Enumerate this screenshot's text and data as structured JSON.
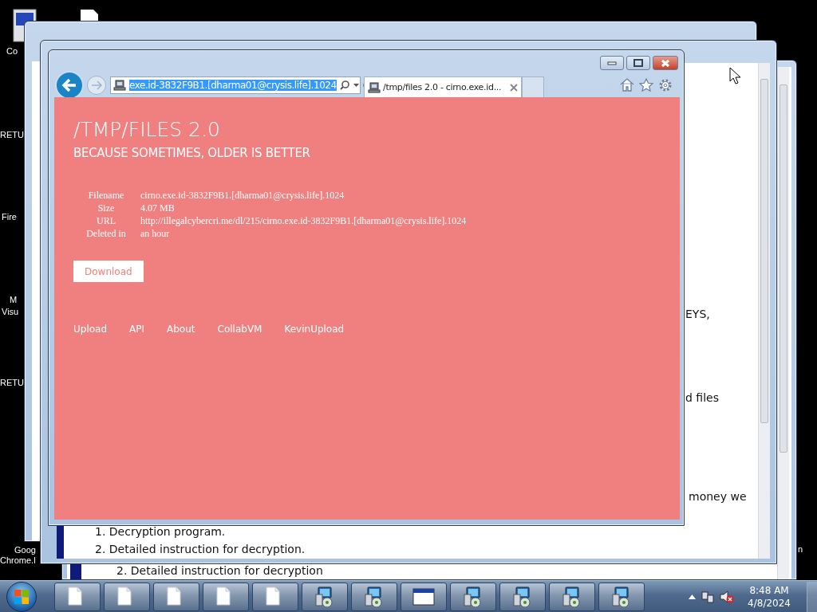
{
  "desktop_icon_labels": [
    "Co",
    "RETU",
    "Fire",
    "M",
    "Visu",
    "RETU",
    "Goog",
    "Chrome.l",
    "n"
  ],
  "rear_window": {
    "list": [
      {
        "number": "2.",
        "text": "Detailed instruction for decryption"
      }
    ]
  },
  "middle_window": {
    "fragments": [
      "EYS,",
      "d files",
      "money we"
    ],
    "list": [
      {
        "number": "1.",
        "text": "Decryption program."
      },
      {
        "number": "2.",
        "text": "Detailed instruction for decryption."
      }
    ]
  },
  "browser": {
    "address": "exe.id-3832F9B1.[dharma01@crysis.life].1024",
    "address_selected": true,
    "tabs": [
      {
        "title": "/tmp/files 2.0 - cirno.exe.id...",
        "selected": true
      }
    ],
    "page": {
      "title": "/TMP/FILES 2.0",
      "subtitle": "BECAUSE SOMETIMES, OLDER IS BETTER",
      "details": [
        {
          "label": "Filename",
          "value": "cirno.exe.id-3832F9B1.[dharma01@crysis.life].1024"
        },
        {
          "label": "Size",
          "value": "4.07 MB"
        },
        {
          "label": "URL",
          "value": "http://illegalcybercri.me/dl/215/cirno.exe.id-3832F9B1.[dharma01@crysis.life].1024"
        },
        {
          "label": "Deleted in",
          "value": "an hour"
        }
      ],
      "download_button": "Download",
      "footer_links": [
        "Upload",
        "API",
        "About",
        "CollabVM",
        "KevinUpload"
      ]
    }
  },
  "taskbar": {
    "buttons": [
      {
        "kind": "file"
      },
      {
        "kind": "file"
      },
      {
        "kind": "file"
      },
      {
        "kind": "file"
      },
      {
        "kind": "file"
      },
      {
        "kind": "installer"
      },
      {
        "kind": "installer"
      },
      {
        "kind": "window"
      },
      {
        "kind": "installer"
      },
      {
        "kind": "installer"
      },
      {
        "kind": "installer"
      },
      {
        "kind": "installer"
      }
    ],
    "time": "8:48 AM",
    "date": "4/8/2024"
  }
}
